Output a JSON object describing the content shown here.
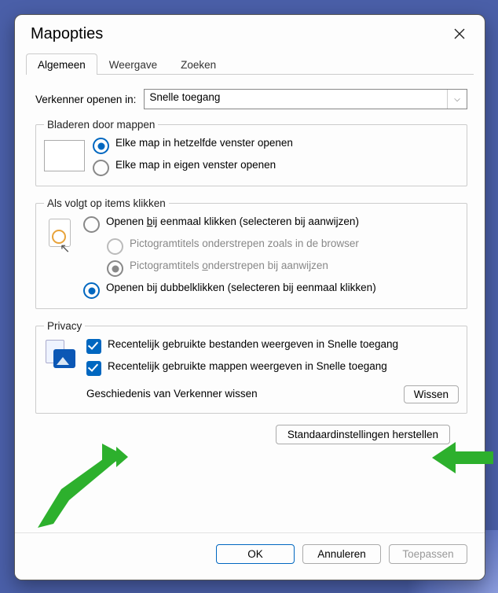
{
  "title": "Mapopties",
  "tabs": [
    "Algemeen",
    "Weergave",
    "Zoeken"
  ],
  "active_tab_index": 0,
  "open_in": {
    "label": "Verkenner openen in:",
    "value": "Snelle toegang"
  },
  "browse": {
    "legend": "Bladeren door mappen",
    "opt_same": "Elke map in hetzelfde venster openen",
    "opt_own": "Elke map in eigen venster openen"
  },
  "click": {
    "legend": "Als volgt op items klikken",
    "single_pre": "Openen ",
    "single_u": "b",
    "single_post": "ij eenmaal klikken (selecteren bij aanwijzen)",
    "under_browser": "Pictogramtitels onderstrepen zoals in de browser",
    "under_point_pre": "Pictogramtitels ",
    "under_point_u": "o",
    "under_point_post": "nderstrepen bij aanwijzen",
    "double": "Openen bij dubbelklikken (selecteren bij eenmaal klikken)"
  },
  "privacy": {
    "legend": "Privacy",
    "recent_files": "Recentelijk gebruikte bestanden weergeven in Snelle toegang",
    "recent_folders": "Recentelijk gebruikte mappen weergeven in Snelle toegang",
    "history_label": "Geschiedenis van Verkenner wissen",
    "clear_pre": "",
    "clear_u": "W",
    "clear_post": "issen"
  },
  "restore_pre": "",
  "restore_u": "S",
  "restore_post": "tandaardinstellingen herstellen",
  "buttons": {
    "ok": "OK",
    "cancel": "Annuleren",
    "apply": "Toepassen"
  },
  "annotation_color": "#2db02d"
}
